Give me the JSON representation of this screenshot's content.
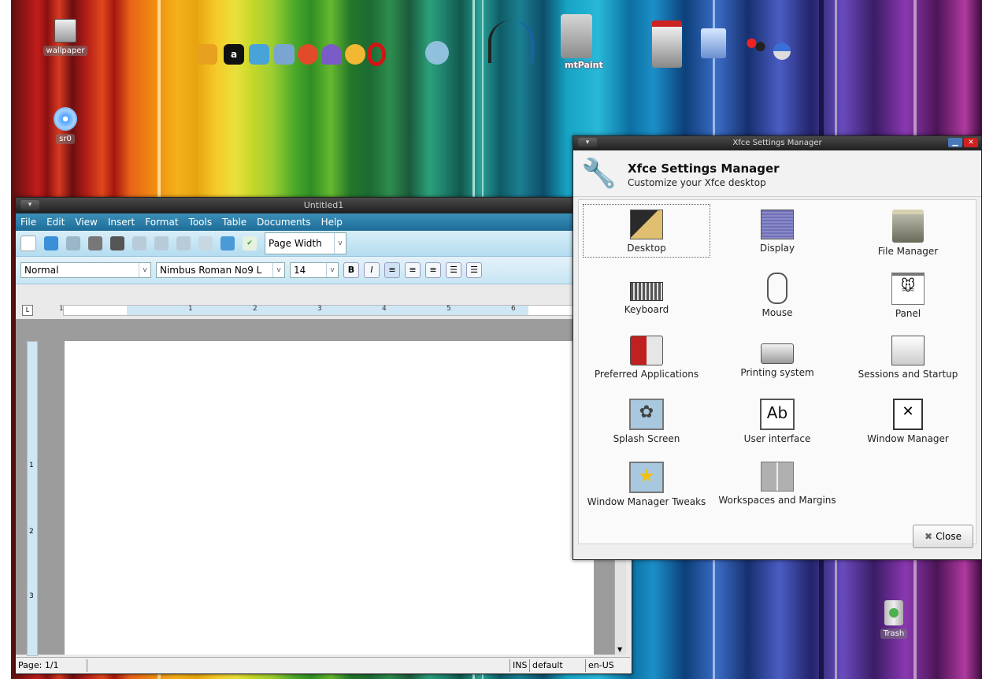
{
  "desktop": {
    "icons": {
      "wallpaper": "wallpaper",
      "sr0": "sr0",
      "trash": "Trash"
    },
    "dock_label": "mtPaint"
  },
  "writer": {
    "title": "Untitled1",
    "menu": [
      "File",
      "Edit",
      "View",
      "Insert",
      "Format",
      "Tools",
      "Table",
      "Documents",
      "Help"
    ],
    "zoom": "Page Width",
    "style": "Normal",
    "font": "Nimbus Roman No9 L",
    "size": "14",
    "bold": "B",
    "italic": "I",
    "ruler_numbers": [
      "1",
      "1",
      "2",
      "3",
      "4",
      "5",
      "6"
    ],
    "vruler_numbers": [
      "1",
      "2",
      "3"
    ],
    "status": {
      "page": "Page: 1/1",
      "ins": "INS",
      "style": "default",
      "lang": "en-US"
    }
  },
  "settings": {
    "window_title": "Xfce Settings Manager",
    "header_title": "Xfce Settings Manager",
    "header_subtitle": "Customize your Xfce desktop",
    "items": [
      "Desktop",
      "Display",
      "File Manager",
      "Keyboard",
      "Mouse",
      "Panel",
      "Preferred Applications",
      "Printing system",
      "Sessions and Startup",
      "Splash Screen",
      "User interface",
      "Window Manager",
      "Window Manager Tweaks",
      "Workspaces and Margins"
    ],
    "close_label": "Close"
  }
}
